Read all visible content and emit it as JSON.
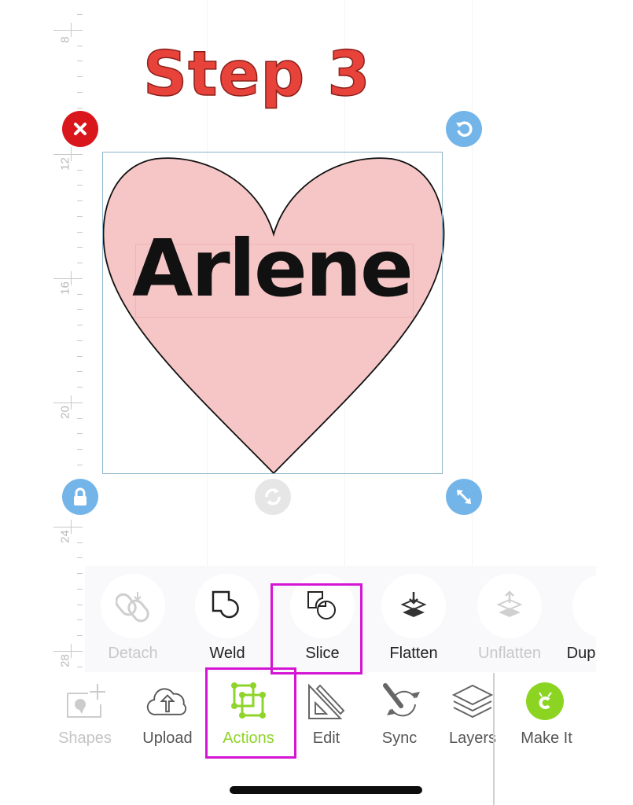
{
  "annotation": {
    "title": "Step 3",
    "title_color": "#e8433a",
    "highlight_color": "#d416d4"
  },
  "ruler": {
    "labels": [
      "8",
      "12",
      "16",
      "20",
      "24",
      "28"
    ]
  },
  "canvas": {
    "design_text": "Arlene",
    "heart_fill": "#f6c6c6",
    "handles": {
      "delete": "delete-icon",
      "rotate": "rotate-icon",
      "lock": "lock-icon",
      "resize": "resize-icon",
      "flip": "flip-icon"
    }
  },
  "actions_panel": {
    "items": [
      {
        "label": "Detach",
        "icon": "detach-icon",
        "enabled": false
      },
      {
        "label": "Weld",
        "icon": "weld-icon",
        "enabled": true
      },
      {
        "label": "Slice",
        "icon": "slice-icon",
        "enabled": true,
        "highlighted": true
      },
      {
        "label": "Flatten",
        "icon": "flatten-icon",
        "enabled": true
      },
      {
        "label": "Unflatten",
        "icon": "unflatten-icon",
        "enabled": false
      },
      {
        "label": "Dup",
        "icon": "duplicate-icon",
        "enabled": true
      }
    ]
  },
  "bottom_nav": {
    "items": [
      {
        "label": "Shapes",
        "icon": "shapes-icon",
        "enabled": false
      },
      {
        "label": "Upload",
        "icon": "upload-icon",
        "enabled": true
      },
      {
        "label": "Actions",
        "icon": "actions-icon",
        "active": true,
        "highlighted": true
      },
      {
        "label": "Edit",
        "icon": "edit-icon",
        "enabled": true
      },
      {
        "label": "Sync",
        "icon": "sync-icon",
        "enabled": true
      },
      {
        "label": "Layers",
        "icon": "layers-icon",
        "enabled": true
      }
    ],
    "make_it": {
      "label": "Make It",
      "color": "#8cd422"
    }
  }
}
